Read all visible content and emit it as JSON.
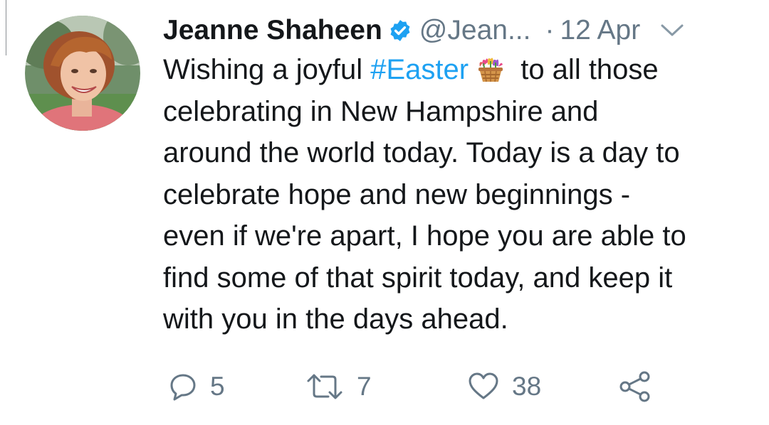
{
  "tweet": {
    "author_name": "Jeanne Shaheen",
    "handle": "@Jean...",
    "separator": "·",
    "date": "12 Apr",
    "text_line1_a": "Wishing a joyful ",
    "hashtag": "#Easter",
    "text_line1_b": " to all those",
    "text_line2": "celebrating in New Hampshire and",
    "text_line3": "around the world today. Today is a day to",
    "text_line4": "celebrate hope and new beginnings -",
    "text_line5": "even if we're apart, I hope you are able to",
    "text_line6": "find some of that spirit today, and keep it",
    "text_line7": "with you in the days ahead.",
    "emoji": "basket-of-tulips-emoji"
  },
  "actions": {
    "reply_count": "5",
    "retweet_count": "7",
    "like_count": "38"
  },
  "icons": [
    "verified-badge-icon",
    "chevron-down-icon",
    "reply-icon",
    "retweet-icon",
    "like-icon",
    "share-icon"
  ],
  "colors": {
    "text": "#14171a",
    "secondary": "#657786",
    "accent": "#1da1f2"
  }
}
